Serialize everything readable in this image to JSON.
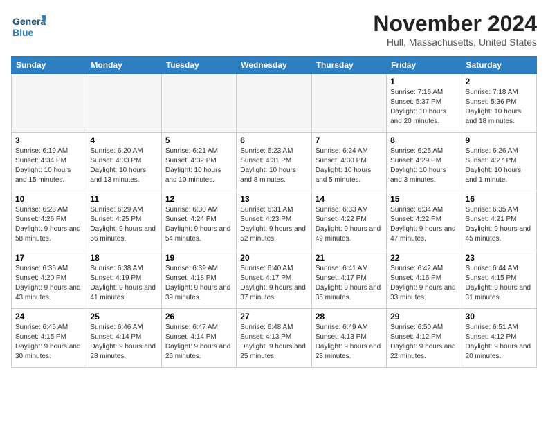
{
  "header": {
    "logo_line1": "General",
    "logo_line2": "Blue",
    "month_title": "November 2024",
    "location": "Hull, Massachusetts, United States"
  },
  "weekdays": [
    "Sunday",
    "Monday",
    "Tuesday",
    "Wednesday",
    "Thursday",
    "Friday",
    "Saturday"
  ],
  "weeks": [
    [
      {
        "day": "",
        "info": ""
      },
      {
        "day": "",
        "info": ""
      },
      {
        "day": "",
        "info": ""
      },
      {
        "day": "",
        "info": ""
      },
      {
        "day": "",
        "info": ""
      },
      {
        "day": "1",
        "info": "Sunrise: 7:16 AM\nSunset: 5:37 PM\nDaylight: 10 hours\nand 20 minutes."
      },
      {
        "day": "2",
        "info": "Sunrise: 7:18 AM\nSunset: 5:36 PM\nDaylight: 10 hours\nand 18 minutes."
      }
    ],
    [
      {
        "day": "3",
        "info": "Sunrise: 6:19 AM\nSunset: 4:34 PM\nDaylight: 10 hours\nand 15 minutes."
      },
      {
        "day": "4",
        "info": "Sunrise: 6:20 AM\nSunset: 4:33 PM\nDaylight: 10 hours\nand 13 minutes."
      },
      {
        "day": "5",
        "info": "Sunrise: 6:21 AM\nSunset: 4:32 PM\nDaylight: 10 hours\nand 10 minutes."
      },
      {
        "day": "6",
        "info": "Sunrise: 6:23 AM\nSunset: 4:31 PM\nDaylight: 10 hours\nand 8 minutes."
      },
      {
        "day": "7",
        "info": "Sunrise: 6:24 AM\nSunset: 4:30 PM\nDaylight: 10 hours\nand 5 minutes."
      },
      {
        "day": "8",
        "info": "Sunrise: 6:25 AM\nSunset: 4:29 PM\nDaylight: 10 hours\nand 3 minutes."
      },
      {
        "day": "9",
        "info": "Sunrise: 6:26 AM\nSunset: 4:27 PM\nDaylight: 10 hours\nand 1 minute."
      }
    ],
    [
      {
        "day": "10",
        "info": "Sunrise: 6:28 AM\nSunset: 4:26 PM\nDaylight: 9 hours\nand 58 minutes."
      },
      {
        "day": "11",
        "info": "Sunrise: 6:29 AM\nSunset: 4:25 PM\nDaylight: 9 hours\nand 56 minutes."
      },
      {
        "day": "12",
        "info": "Sunrise: 6:30 AM\nSunset: 4:24 PM\nDaylight: 9 hours\nand 54 minutes."
      },
      {
        "day": "13",
        "info": "Sunrise: 6:31 AM\nSunset: 4:23 PM\nDaylight: 9 hours\nand 52 minutes."
      },
      {
        "day": "14",
        "info": "Sunrise: 6:33 AM\nSunset: 4:22 PM\nDaylight: 9 hours\nand 49 minutes."
      },
      {
        "day": "15",
        "info": "Sunrise: 6:34 AM\nSunset: 4:22 PM\nDaylight: 9 hours\nand 47 minutes."
      },
      {
        "day": "16",
        "info": "Sunrise: 6:35 AM\nSunset: 4:21 PM\nDaylight: 9 hours\nand 45 minutes."
      }
    ],
    [
      {
        "day": "17",
        "info": "Sunrise: 6:36 AM\nSunset: 4:20 PM\nDaylight: 9 hours\nand 43 minutes."
      },
      {
        "day": "18",
        "info": "Sunrise: 6:38 AM\nSunset: 4:19 PM\nDaylight: 9 hours\nand 41 minutes."
      },
      {
        "day": "19",
        "info": "Sunrise: 6:39 AM\nSunset: 4:18 PM\nDaylight: 9 hours\nand 39 minutes."
      },
      {
        "day": "20",
        "info": "Sunrise: 6:40 AM\nSunset: 4:17 PM\nDaylight: 9 hours\nand 37 minutes."
      },
      {
        "day": "21",
        "info": "Sunrise: 6:41 AM\nSunset: 4:17 PM\nDaylight: 9 hours\nand 35 minutes."
      },
      {
        "day": "22",
        "info": "Sunrise: 6:42 AM\nSunset: 4:16 PM\nDaylight: 9 hours\nand 33 minutes."
      },
      {
        "day": "23",
        "info": "Sunrise: 6:44 AM\nSunset: 4:15 PM\nDaylight: 9 hours\nand 31 minutes."
      }
    ],
    [
      {
        "day": "24",
        "info": "Sunrise: 6:45 AM\nSunset: 4:15 PM\nDaylight: 9 hours\nand 30 minutes."
      },
      {
        "day": "25",
        "info": "Sunrise: 6:46 AM\nSunset: 4:14 PM\nDaylight: 9 hours\nand 28 minutes."
      },
      {
        "day": "26",
        "info": "Sunrise: 6:47 AM\nSunset: 4:14 PM\nDaylight: 9 hours\nand 26 minutes."
      },
      {
        "day": "27",
        "info": "Sunrise: 6:48 AM\nSunset: 4:13 PM\nDaylight: 9 hours\nand 25 minutes."
      },
      {
        "day": "28",
        "info": "Sunrise: 6:49 AM\nSunset: 4:13 PM\nDaylight: 9 hours\nand 23 minutes."
      },
      {
        "day": "29",
        "info": "Sunrise: 6:50 AM\nSunset: 4:12 PM\nDaylight: 9 hours\nand 22 minutes."
      },
      {
        "day": "30",
        "info": "Sunrise: 6:51 AM\nSunset: 4:12 PM\nDaylight: 9 hours\nand 20 minutes."
      }
    ]
  ]
}
